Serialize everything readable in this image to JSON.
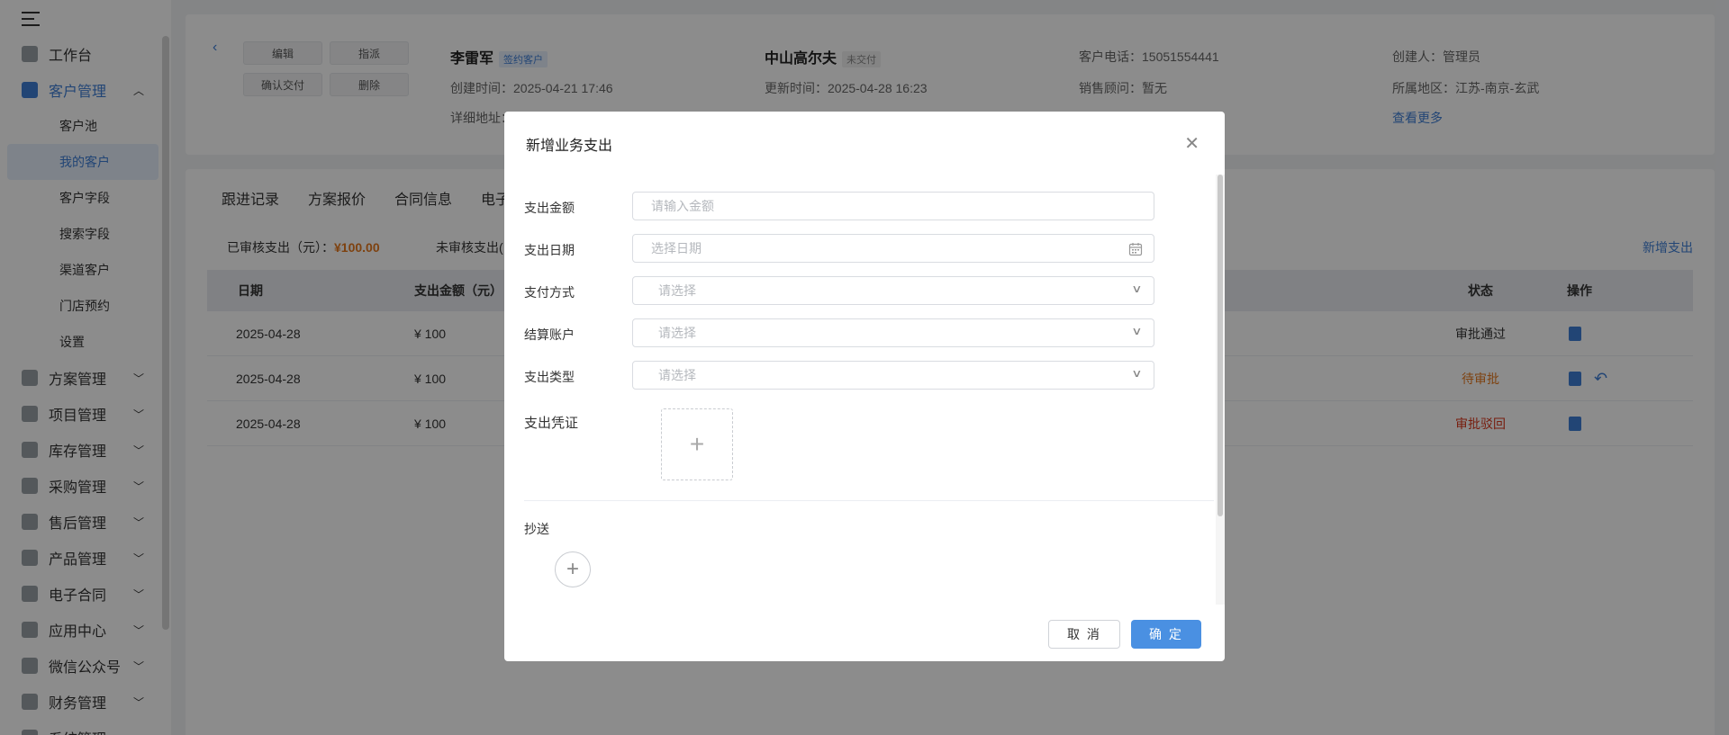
{
  "sidebar": {
    "items": [
      {
        "label": "工作台"
      },
      {
        "label": "客户管理"
      },
      {
        "label": "方案管理"
      },
      {
        "label": "项目管理"
      },
      {
        "label": "库存管理"
      },
      {
        "label": "采购管理"
      },
      {
        "label": "售后管理"
      },
      {
        "label": "产品管理"
      },
      {
        "label": "电子合同"
      },
      {
        "label": "应用中心"
      },
      {
        "label": "微信公众号"
      },
      {
        "label": "财务管理"
      },
      {
        "label": "系统管理"
      }
    ],
    "sub_items": [
      "客户池",
      "我的客户",
      "客户字段",
      "搜索字段",
      "渠道客户",
      "门店预约",
      "设置"
    ]
  },
  "customer": {
    "buttons": {
      "edit": "编辑",
      "assign": "指派",
      "confirm_delivery": "确认交付",
      "delete": "删除"
    },
    "name": "李雷军",
    "name_tag": "签约客户",
    "created": "创建时间：2025-04-21 17:46",
    "address": "详细地址：",
    "project": "中山高尔夫",
    "project_tag": "未交付",
    "updated": "更新时间：2025-04-28 16:23",
    "phone": "客户电话：15051554441",
    "sales": "销售顾问：暂无",
    "creator": "创建人：管理员",
    "region": "所属地区：江苏-南京-玄武",
    "more": "查看更多"
  },
  "tabs": [
    "跟进记录",
    "方案报价",
    "合同信息",
    "电子"
  ],
  "summary": {
    "approved_label": "已审核支出（元）：",
    "approved_amount": "¥100.00",
    "pending_label": "未审核支出(",
    "add_link": "新增支出"
  },
  "table": {
    "headers": {
      "date": "日期",
      "amount": "支出金额（元）",
      "status": "状态",
      "ops": "操作"
    },
    "rows": [
      {
        "date": "2025-04-28",
        "amount": "¥ 100",
        "status": "审批通过"
      },
      {
        "date": "2025-04-28",
        "amount": "¥ 100",
        "status": "待审批"
      },
      {
        "date": "2025-04-28",
        "amount": "¥ 100",
        "status": "审批驳回"
      }
    ]
  },
  "modal": {
    "title": "新增业务支出",
    "fields": {
      "amount_label": "支出金额",
      "amount_placeholder": "请输入金额",
      "date_label": "支出日期",
      "date_placeholder": "选择日期",
      "pay_label": "支付方式",
      "pay_placeholder": "请选择",
      "account_label": "结算账户",
      "account_placeholder": "请选择",
      "type_label": "支出类型",
      "type_placeholder": "请选择",
      "voucher_label": "支出凭证",
      "cc_label": "抄送"
    },
    "cancel": "取 消",
    "ok": "确 定"
  },
  "colors": {
    "primary": "#4a90e2",
    "accent": "#3e7fd6",
    "warning": "#e6781e",
    "danger": "#d9361b"
  }
}
